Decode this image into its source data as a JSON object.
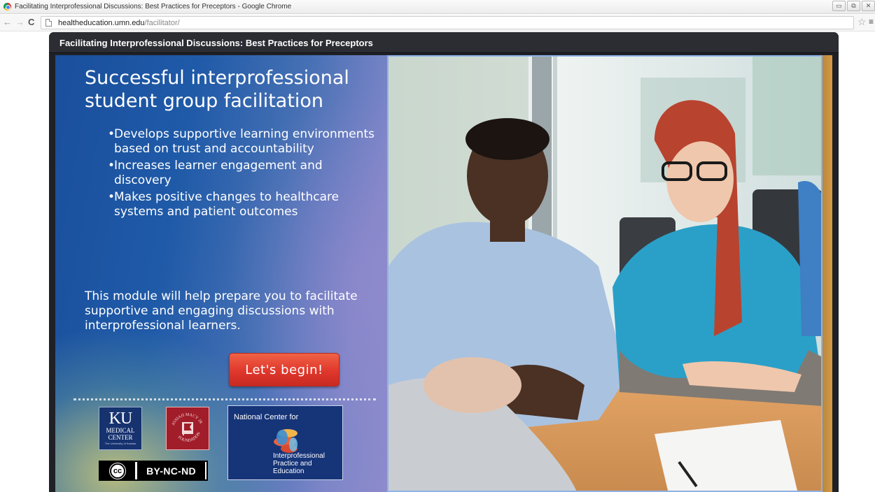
{
  "browser": {
    "window_title": "Facilitating Interprofessional Discussions: Best Practices for Preceptors - Google Chrome",
    "url_host": "healtheducation.umn.edu",
    "url_path": "/facilitator/",
    "icons": [
      "back-icon",
      "forward-icon",
      "reload-icon",
      "page-icon",
      "star-icon",
      "menu-icon"
    ]
  },
  "module": {
    "title": "Facilitating Interprofessional Discussions: Best Practices for Preceptors"
  },
  "content": {
    "headline": "Successful interprofessional student group facilitation",
    "bullets": [
      "Develops supportive learning environments based on trust and accountability",
      "Increases learner engagement and discovery",
      "Makes positive changes to healthcare systems and patient outcomes"
    ],
    "bullet_glyph": "•",
    "intro": "This module will help prepare you to facilitate supportive and engaging discussions with interprofessional learners.",
    "begin_button": "Let's begin!"
  },
  "logos": {
    "ku_big": "KU",
    "ku_small_1": "MEDICAL",
    "ku_small_2": "CENTER",
    "ku_tiny": "The University of Kansas",
    "macy_text": "JOSIAH MACY JR FOUNDATION",
    "nc_line1": "National Center for",
    "nc_line2": "Interprofessional Practice and Education",
    "cc_symbol": "cc",
    "cc_license": "BY-NC-ND"
  },
  "colors": {
    "button": "#e0372c",
    "panel_blue": "#1f5aa8",
    "header": "#2b2d33"
  }
}
